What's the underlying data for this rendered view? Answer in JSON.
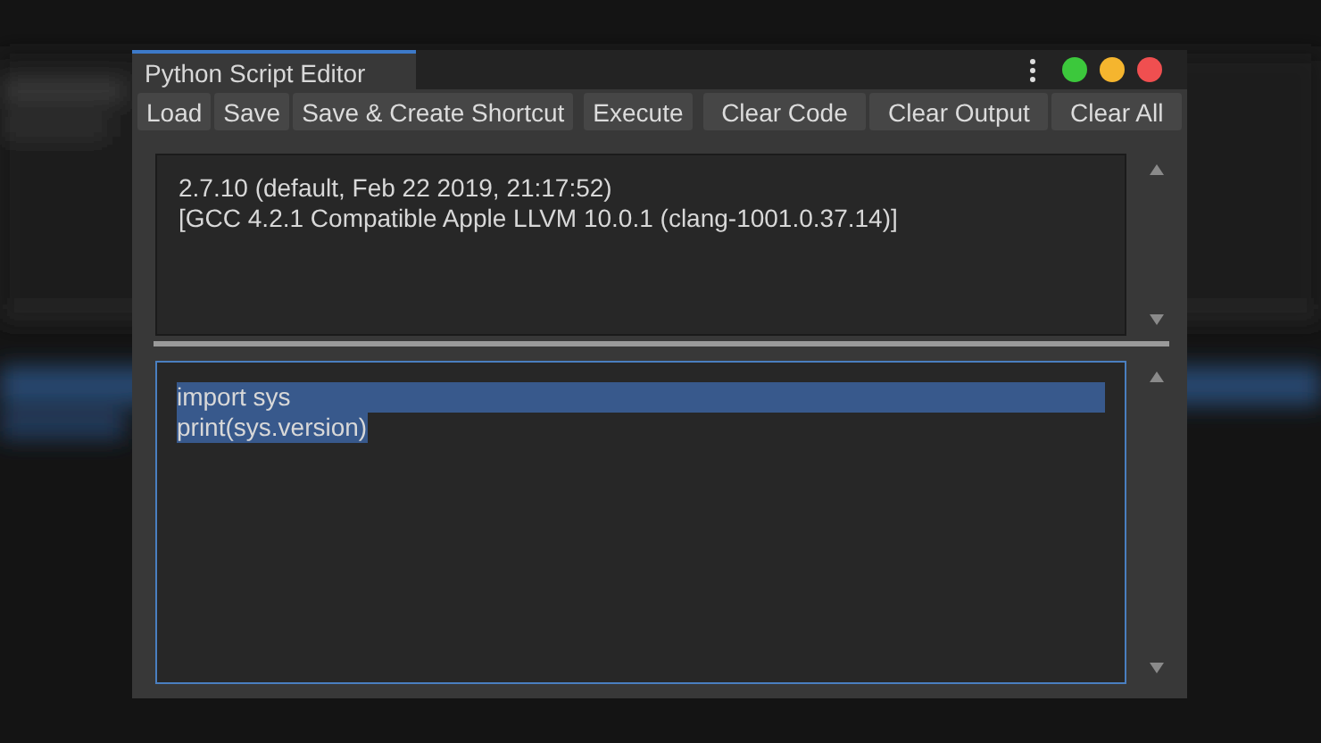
{
  "window": {
    "title": "Python Script Editor",
    "controls": [
      {
        "color": "#3cc83c"
      },
      {
        "color": "#f5b52e"
      },
      {
        "color": "#f04f50"
      }
    ]
  },
  "toolbar": [
    [
      "Load",
      "Save",
      "Save & Create Shortcut"
    ],
    [
      "Execute"
    ],
    [
      "Clear Code",
      "Clear Output",
      "Clear All"
    ]
  ],
  "output": [
    "2.7.10 (default, Feb 22 2019, 21:17:52)",
    "[GCC 4.2.1 Compatible Apple LLVM 10.0.1 (clang-1001.0.37.14)]"
  ],
  "code": [
    {
      "text": "import sys",
      "selected": true
    },
    {
      "text": "print(sys.version)",
      "selected": true
    }
  ]
}
